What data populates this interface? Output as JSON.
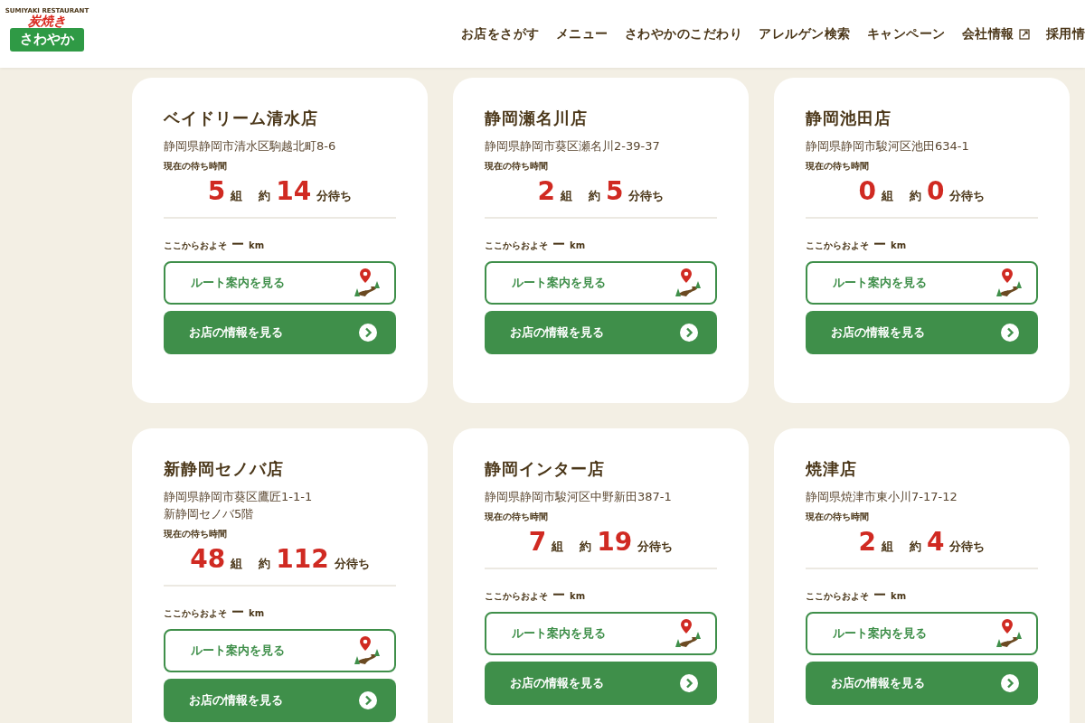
{
  "header": {
    "logo": {
      "arc": "SUMIYAKI RESTAURANT",
      "top": "炭焼き",
      "bottom": "さわやか"
    },
    "nav": [
      {
        "label": "お店をさがす",
        "external": false
      },
      {
        "label": "メニュー",
        "external": false
      },
      {
        "label": "さわやかのこだわり",
        "external": false
      },
      {
        "label": "アレルゲン検索",
        "external": false
      },
      {
        "label": "キャンペーン",
        "external": false
      },
      {
        "label": "会社情報",
        "external": true
      },
      {
        "label": "採用情",
        "external": false
      }
    ]
  },
  "shops": [
    {
      "name": "ベイドリーム清水店",
      "address": [
        "静岡県静岡市清水区駒越北町8-6"
      ],
      "wait_label": "現在の待ち時間",
      "groups": "5",
      "groups_unit": "組",
      "approx": "約",
      "minutes": "14",
      "minutes_unit": "分待ち",
      "distance_label": "ここからおよそ",
      "distance": "ー",
      "distance_unit": "km",
      "route_button": "ルート案内を見る",
      "info_button": "お店の情報を見る"
    },
    {
      "name": "静岡瀬名川店",
      "address": [
        "静岡県静岡市葵区瀬名川2-39-37"
      ],
      "wait_label": "現在の待ち時間",
      "groups": "2",
      "groups_unit": "組",
      "approx": "約",
      "minutes": "5",
      "minutes_unit": "分待ち",
      "distance_label": "ここからおよそ",
      "distance": "ー",
      "distance_unit": "km",
      "route_button": "ルート案内を見る",
      "info_button": "お店の情報を見る"
    },
    {
      "name": "静岡池田店",
      "address": [
        "静岡県静岡市駿河区池田634-1"
      ],
      "wait_label": "現在の待ち時間",
      "groups": "0",
      "groups_unit": "組",
      "approx": "約",
      "minutes": "0",
      "minutes_unit": "分待ち",
      "distance_label": "ここからおよそ",
      "distance": "ー",
      "distance_unit": "km",
      "route_button": "ルート案内を見る",
      "info_button": "お店の情報を見る"
    },
    {
      "name": "新静岡セノバ店",
      "address": [
        "静岡県静岡市葵区鷹匠1-1-1",
        "新静岡セノバ5階"
      ],
      "wait_label": "現在の待ち時間",
      "groups": "48",
      "groups_unit": "組",
      "approx": "約",
      "minutes": "112",
      "minutes_unit": "分待ち",
      "distance_label": "ここからおよそ",
      "distance": "ー",
      "distance_unit": "km",
      "route_button": "ルート案内を見る",
      "info_button": "お店の情報を見る"
    },
    {
      "name": "静岡インター店",
      "address": [
        "静岡県静岡市駿河区中野新田387-1"
      ],
      "wait_label": "現在の待ち時間",
      "groups": "7",
      "groups_unit": "組",
      "approx": "約",
      "minutes": "19",
      "minutes_unit": "分待ち",
      "distance_label": "ここからおよそ",
      "distance": "ー",
      "distance_unit": "km",
      "route_button": "ルート案内を見る",
      "info_button": "お店の情報を見る"
    },
    {
      "name": "焼津店",
      "address": [
        "静岡県焼津市東小川7-17-12"
      ],
      "wait_label": "現在の待ち時間",
      "groups": "2",
      "groups_unit": "組",
      "approx": "約",
      "minutes": "4",
      "minutes_unit": "分待ち",
      "distance_label": "ここからおよそ",
      "distance": "ー",
      "distance_unit": "km",
      "route_button": "ルート案内を見る",
      "info_button": "お店の情報を見る"
    }
  ]
}
